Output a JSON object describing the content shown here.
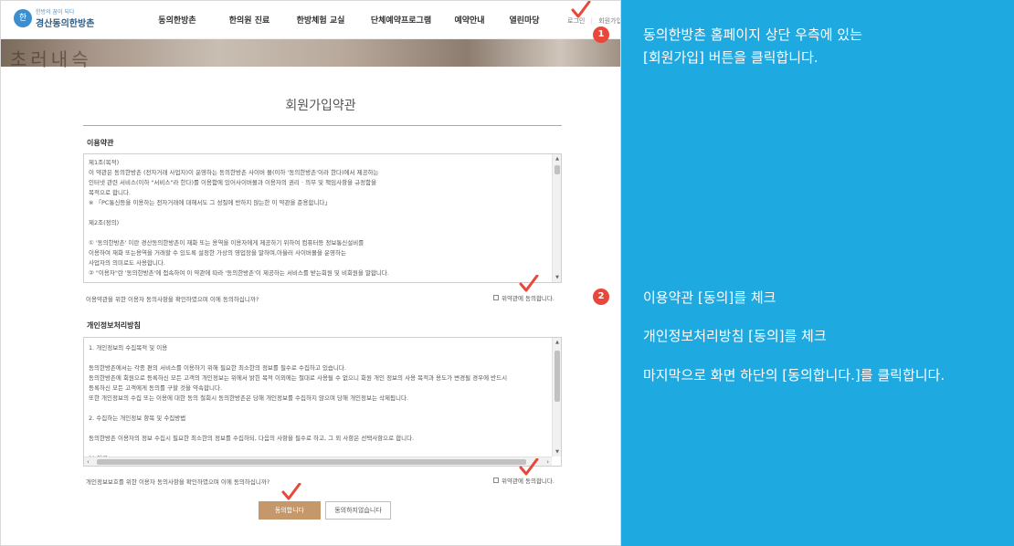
{
  "header": {
    "logo_symbol": "한",
    "logo_sub": "한방의 꿈이 되다",
    "logo_main": "경산동의한방촌",
    "nav": [
      "동의한방촌",
      "한의원 진료",
      "한방체험 교실",
      "단체예약프로그램",
      "예약안내",
      "열린마당"
    ],
    "login": "로그인",
    "divider": "|",
    "join": "회원가입"
  },
  "hero": {
    "banner_text": "초러내슥"
  },
  "page": {
    "title": "회원가입약관",
    "terms": {
      "heading": "이용약관",
      "lines": [
        "제1조(목적)",
        "이 약관은 동의한방촌 (전자거래 사업자)이 운영하는 동의한방촌 사이버 몰(이하 '동의한방촌'이라 한다)에서 제공하는",
        "인터넷 관련 서비스(이하 \"서비스\"라 한다)를 이용함에 있어사이버몰과 이용자의 권리 · 의무 및 책임사항을 규정함을",
        "목적으로 합니다.",
        "※ 「PC통신등을 이용하는 전자거래에 대해서도 그 성질에 반하지 않는한 이 약관을 준용합니다」",
        "",
        "제2조(정의)",
        "",
        "① '동의한방촌' 이란 경산동의한방촌이 재화 또는 용역을 이용자에게 제공하기 위하여 컴퓨터등 정보통신설비를",
        "이용하여 재화 또는용역을 거래할 수 있도록 설정한 가상의 영업장을 말하며,아울러 사이버몰을 운영하는",
        "사업자의 의미로도 사용합니다.",
        "② \"이용자\"란 '동의한방촌'에 접속하여 이 약관에 따라 '동의한방촌'이 제공하는 서비스를 받는회원 및 비회원을 말합니다."
      ],
      "confirm": "이용약관을 위한 이용자 동의사항을 확인하였으며 이에 동의하십니까?",
      "agree_label": "위약관에 동의합니다."
    },
    "privacy": {
      "heading": "개인정보처리방침",
      "lines": [
        "1. 개인정보의 수집목적 및 이용",
        "",
        "동의한방촌에서는 각종 편의 서비스를 이용하기 위해 필요한 최소한의 정보를 필수로 수집하고 있습니다.",
        "동의한방촌에 회원으로 등록하신 모든 고객의 개인정보는 위에서 밝힌 목적 이외에는 절대로 사용될 수 없으니 회원 개인 정보의 사용 목적과 용도가 변경될 경우에 반드시",
        "등록하신 모든 고객에게 동의를 구할 것을 약속합니다.",
        "또한 개인정보의 수집 또는 이용에 대한 동의 철회시 동의한방촌은 당해 개인정보를 수집하지 않으며 당해 개인정보는 삭제됩니다.",
        "",
        "2. 수집하는 개인정보 항목 및 수집방법",
        "",
        "동의한방촌 이용자의 정보 수집시 필요한 최소한의 정보를 수집하되, 다음의 사항을 필수로 하고, 그 외 사항은 선택사항으로 합니다.",
        "",
        "1) 이름"
      ],
      "confirm": "개인정보보호를 위한 이용자 동의사항을 확인하였으며 이에 동의하십니까?",
      "agree_label": "위약관에 동의합니다."
    },
    "buttons": {
      "agree": "동의합니다",
      "disagree": "동의하지않습니다"
    }
  },
  "steps": {
    "one": "1",
    "two": "2"
  },
  "guide": {
    "step1_line1": "동의한방촌 홈페이지 상단 우측에 있는",
    "step1_line2": "[회원가입] 버튼을 클릭합니다.",
    "step2_line1": "이용약관 [동의]를 체크",
    "step2_line2": "개인정보처리방침 [동의]를 체크",
    "step2_line3": "마지막으로 화면 하단의 [동의합니다.]를 클릭합니다."
  },
  "colors": {
    "guide_bg": "#1fa9e1",
    "badge": "#e9473b",
    "checkmark": "#e9473b",
    "agree_button": "#c4986a",
    "title_rule": "#c9a76a"
  },
  "icons": {
    "checkmark": "checkmark-icon",
    "logo": "logo-mark-icon",
    "scroll_up": "arrow-up-icon",
    "scroll_down": "arrow-down-icon",
    "scroll_left": "arrow-left-icon",
    "scroll_right": "arrow-right-icon"
  }
}
